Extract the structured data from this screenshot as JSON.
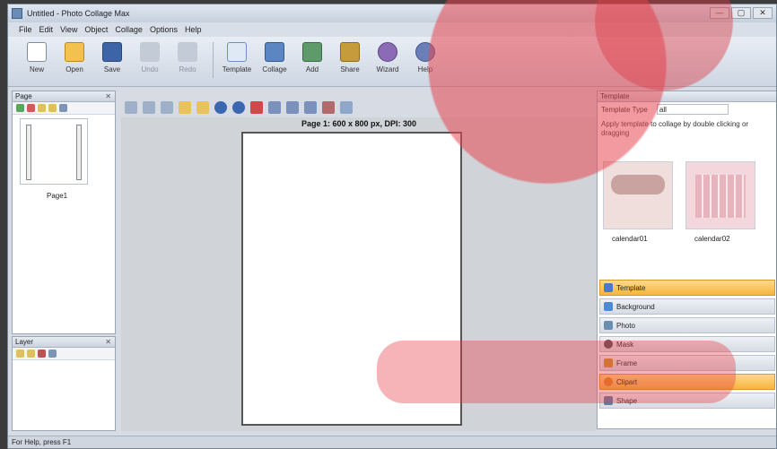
{
  "window": {
    "title": "Untitled - Photo Collage Max",
    "min": "—",
    "max": "▢",
    "close": "✕"
  },
  "menu": [
    "File",
    "Edit",
    "View",
    "Object",
    "Collage",
    "Options",
    "Help"
  ],
  "toolbar": [
    {
      "label": "New",
      "icon": "new-icon",
      "dim": false
    },
    {
      "label": "Open",
      "icon": "open-folder-icon",
      "dim": false
    },
    {
      "label": "Save",
      "icon": "save-icon",
      "dim": false
    },
    {
      "label": "Undo",
      "icon": "undo-icon",
      "dim": true
    },
    {
      "label": "Redo",
      "icon": "redo-icon",
      "dim": true
    },
    {
      "label": "Template",
      "icon": "template-icon",
      "dim": false
    },
    {
      "label": "Collage",
      "icon": "collage-icon",
      "dim": false
    },
    {
      "label": "Add",
      "icon": "add-icon",
      "dim": false
    },
    {
      "label": "Share",
      "icon": "share-icon",
      "dim": false
    },
    {
      "label": "Wizard",
      "icon": "wizard-icon",
      "dim": false
    },
    {
      "label": "Help",
      "icon": "help-icon",
      "dim": false
    }
  ],
  "pages_panel": {
    "title": "Page",
    "thumb_label": "Page1"
  },
  "layers_panel": {
    "title": "Layer"
  },
  "canvas": {
    "caption": "Page 1: 600 x 800 px, DPI: 300"
  },
  "template_panel": {
    "title": "Template",
    "type_label": "Template Type",
    "type_value": "all",
    "hint": "Apply template to collage by double clicking or dragging",
    "items": [
      "calendar01",
      "calendar02"
    ]
  },
  "categories": [
    {
      "label": "Template",
      "active": true,
      "color": "#4a7bc4"
    },
    {
      "label": "Background",
      "active": false,
      "color": "#4a8bd6"
    },
    {
      "label": "Photo",
      "active": false,
      "color": "#6b8fb3"
    },
    {
      "label": "Mask",
      "active": false,
      "color": "#555555"
    },
    {
      "label": "Frame",
      "active": false,
      "color": "#c8962f"
    },
    {
      "label": "Clipart",
      "active": true,
      "color": "#e08a1e"
    },
    {
      "label": "Shape",
      "active": false,
      "color": "#5a7fa8"
    }
  ],
  "status": "For Help, press F1"
}
